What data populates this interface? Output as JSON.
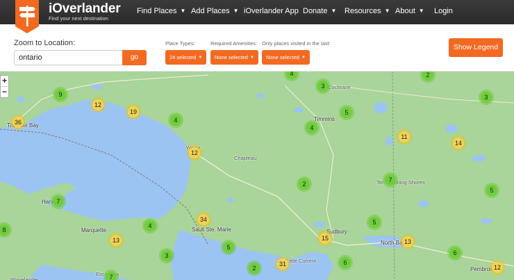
{
  "nav": {
    "brand_title": "iOverlander",
    "brand_tagline": "Find your next destination",
    "items": [
      {
        "label": "Find Places",
        "dropdown": true
      },
      {
        "label": "Add Places",
        "dropdown": true
      },
      {
        "label": "iOverlander App",
        "dropdown": false
      },
      {
        "label": "Donate",
        "dropdown": true
      },
      {
        "label": "Resources",
        "dropdown": true
      },
      {
        "label": "About",
        "dropdown": true
      },
      {
        "label": "Login",
        "dropdown": false
      }
    ]
  },
  "toolbar": {
    "zoom_label": "Zoom to Location:",
    "zoom_value": "ontario",
    "go_label": "go",
    "place_types_label": "Place Types:",
    "place_types_value": "24 selected",
    "amenities_label": "Required Amenities:",
    "amenities_value": "None selected",
    "visited_label": "Only places visited in the last:",
    "visited_value": "None selected",
    "legend_label": "Show Legend"
  },
  "map": {
    "zoom_in": "+",
    "zoom_out": "−",
    "colors": {
      "water": "#9cc4f2",
      "land": "#a9d49a",
      "accent": "#f26a22"
    },
    "places": [
      {
        "name": "Thunder Bay",
        "faint": false
      },
      {
        "name": "Hancock",
        "faint": false
      },
      {
        "name": "Marquette",
        "faint": false
      },
      {
        "name": "Escanaba",
        "faint": true
      },
      {
        "name": "Rhinelander",
        "faint": true
      },
      {
        "name": "Sault Ste. Marie",
        "faint": false
      },
      {
        "name": "Chapleau",
        "faint": true
      },
      {
        "name": "Timmins",
        "faint": false
      },
      {
        "name": "Cochrane",
        "faint": true
      },
      {
        "name": "Sudbury",
        "faint": false
      },
      {
        "name": "North Bay",
        "faint": false
      },
      {
        "name": "Little Current",
        "faint": true
      },
      {
        "name": "Pembroke",
        "faint": false
      },
      {
        "name": "Wawa",
        "faint": true
      },
      {
        "name": "Temiskaming Shores",
        "faint": true
      }
    ],
    "clusters": [
      {
        "count": "4",
        "tone": "green"
      },
      {
        "count": "2",
        "tone": "green"
      },
      {
        "count": "3",
        "tone": "green"
      },
      {
        "count": "9",
        "tone": "green"
      },
      {
        "count": "12",
        "tone": "yellow"
      },
      {
        "count": "19",
        "tone": "yellow"
      },
      {
        "count": "3",
        "tone": "green"
      },
      {
        "count": "5",
        "tone": "green"
      },
      {
        "count": "4",
        "tone": "green"
      },
      {
        "count": "36",
        "tone": "yellow"
      },
      {
        "count": "4",
        "tone": "green"
      },
      {
        "count": "12",
        "tone": "yellow"
      },
      {
        "count": "11",
        "tone": "yellow"
      },
      {
        "count": "14",
        "tone": "yellow"
      },
      {
        "count": "2",
        "tone": "green"
      },
      {
        "count": "7",
        "tone": "green"
      },
      {
        "count": "5",
        "tone": "green"
      },
      {
        "count": "7",
        "tone": "green"
      },
      {
        "count": "8",
        "tone": "green"
      },
      {
        "count": "34",
        "tone": "yellow"
      },
      {
        "count": "4",
        "tone": "green"
      },
      {
        "count": "13",
        "tone": "yellow"
      },
      {
        "count": "5",
        "tone": "green"
      },
      {
        "count": "15",
        "tone": "yellow"
      },
      {
        "count": "5",
        "tone": "green"
      },
      {
        "count": "13",
        "tone": "yellow"
      },
      {
        "count": "3",
        "tone": "green"
      },
      {
        "count": "6",
        "tone": "green"
      },
      {
        "count": "2",
        "tone": "green"
      },
      {
        "count": "31",
        "tone": "yellow"
      },
      {
        "count": "6",
        "tone": "green"
      },
      {
        "count": "12",
        "tone": "yellow"
      },
      {
        "count": "7",
        "tone": "green"
      }
    ]
  }
}
